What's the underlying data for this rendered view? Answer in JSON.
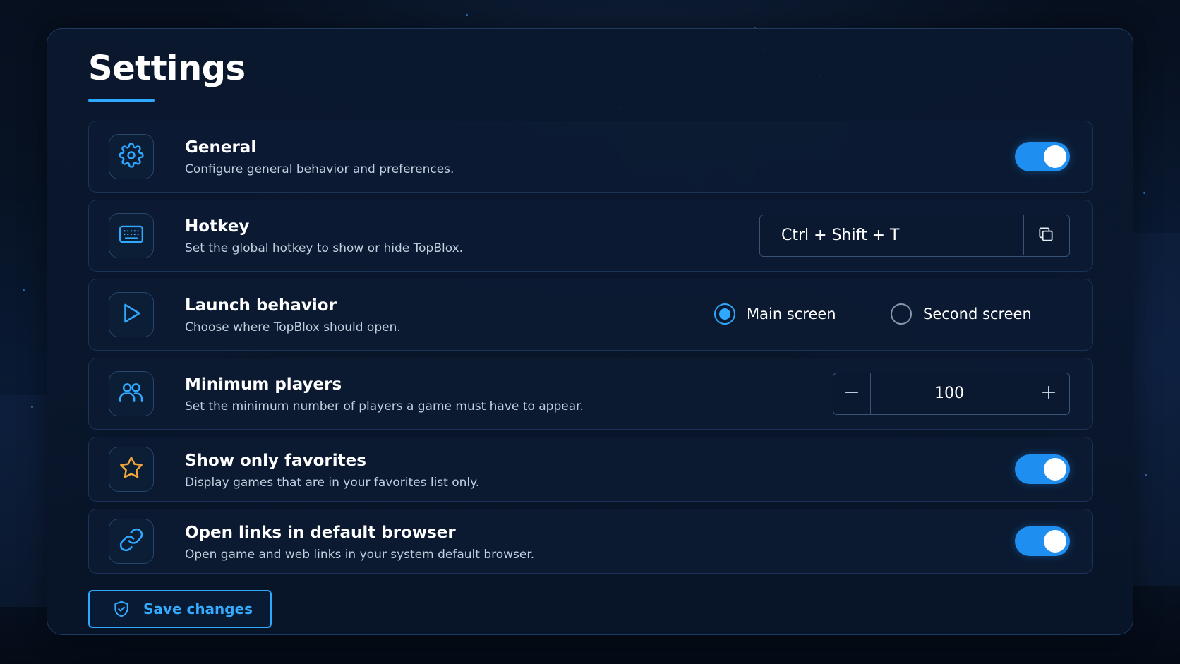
{
  "page": {
    "title": "Settings"
  },
  "settings": [
    {
      "id": "general",
      "icon": "gear-icon",
      "title": "General",
      "description": "Configure general behavior and preferences.",
      "control": "toggle",
      "enabled": true
    },
    {
      "id": "hotkey",
      "icon": "keyboard-icon",
      "title": "Hotkey",
      "description": "Set the global hotkey to show or hide TopBlox.",
      "control": "hotkey",
      "value": "Ctrl + Shift + T"
    },
    {
      "id": "launch-behavior",
      "icon": "play-icon",
      "title": "Launch behavior",
      "description": "Choose where TopBlox should open.",
      "control": "radio",
      "options": [
        "Main screen",
        "Second screen"
      ],
      "selected": "Main screen"
    },
    {
      "id": "minimum-players",
      "icon": "users-icon",
      "title": "Minimum players",
      "description": "Set the minimum number of players a game must have to appear.",
      "control": "stepper",
      "value": "100"
    },
    {
      "id": "show-only-favorites",
      "icon": "star-icon",
      "title": "Show only favorites",
      "description": "Display games that are in your favorites list only.",
      "control": "toggle",
      "enabled": true
    },
    {
      "id": "open-links-default-browser",
      "icon": "link-icon",
      "title": "Open links in default browser",
      "description": "Open game and web links in your system default browser.",
      "control": "toggle",
      "enabled": true
    }
  ],
  "save_button": {
    "label": "Save changes",
    "icon": "shield-check-icon"
  },
  "colors": {
    "accent": "#2fa8ff",
    "toggle_on": "#1e8ef0",
    "star_icon": "#f2a53a",
    "panel_border": "#1e3a63"
  }
}
